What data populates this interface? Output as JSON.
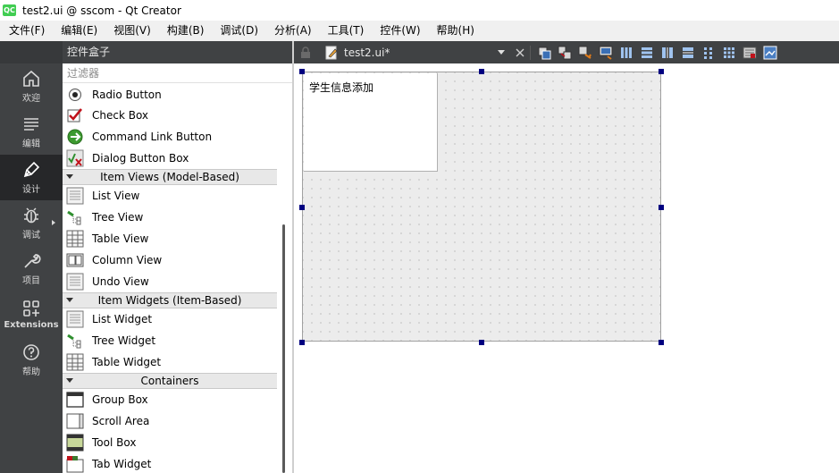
{
  "titlebar": {
    "logo": "QC",
    "title": "test2.ui @ sscom - Qt Creator"
  },
  "menubar": {
    "items": [
      "文件(F)",
      "编辑(E)",
      "视图(V)",
      "构建(B)",
      "调试(D)",
      "分析(A)",
      "工具(T)",
      "控件(W)",
      "帮助(H)"
    ]
  },
  "modebar": {
    "items": [
      {
        "label": "欢迎",
        "icon": "home-icon"
      },
      {
        "label": "编辑",
        "icon": "edit-lines-icon"
      },
      {
        "label": "设计",
        "icon": "pen-icon",
        "active": true
      },
      {
        "label": "调试",
        "icon": "bug-icon"
      },
      {
        "label": "项目",
        "icon": "wrench-icon"
      },
      {
        "label": "Extensions",
        "icon": "extensions-icon"
      },
      {
        "label": "帮助",
        "icon": "help-icon"
      }
    ]
  },
  "widgetbox": {
    "title": "控件盒子",
    "filter_placeholder": "过滤器",
    "buttons_items": [
      "Radio Button",
      "Check Box",
      "Command Link Button",
      "Dialog Button Box"
    ],
    "categories": {
      "item_views": "Item Views (Model-Based)",
      "item_widgets": "Item Widgets (Item-Based)",
      "containers": "Containers"
    },
    "item_views": [
      "List View",
      "Tree View",
      "Table View",
      "Column View",
      "Undo View"
    ],
    "item_widgets": [
      "List Widget",
      "Tree Widget",
      "Table Widget"
    ],
    "containers": [
      "Group Box",
      "Scroll Area",
      "Tool Box",
      "Tab Widget"
    ]
  },
  "editor": {
    "document_title": "test2.ui*",
    "toolbar_icons": [
      "edit-widgets-icon",
      "edit-signals-icon",
      "edit-buddies-icon",
      "edit-taborder-icon",
      "layout-horizontal-icon",
      "layout-vertical-icon",
      "layout-h-splitter-icon",
      "layout-v-splitter-icon",
      "layout-form-icon",
      "layout-grid-icon",
      "break-layout-icon",
      "adjust-size-icon"
    ]
  },
  "form": {
    "groupbox_title": "学生信息添加"
  },
  "colors": {
    "sidebar": "#404244",
    "sidebar_active": "#262729",
    "handle": "#000080",
    "form_bg": "#ececec"
  }
}
